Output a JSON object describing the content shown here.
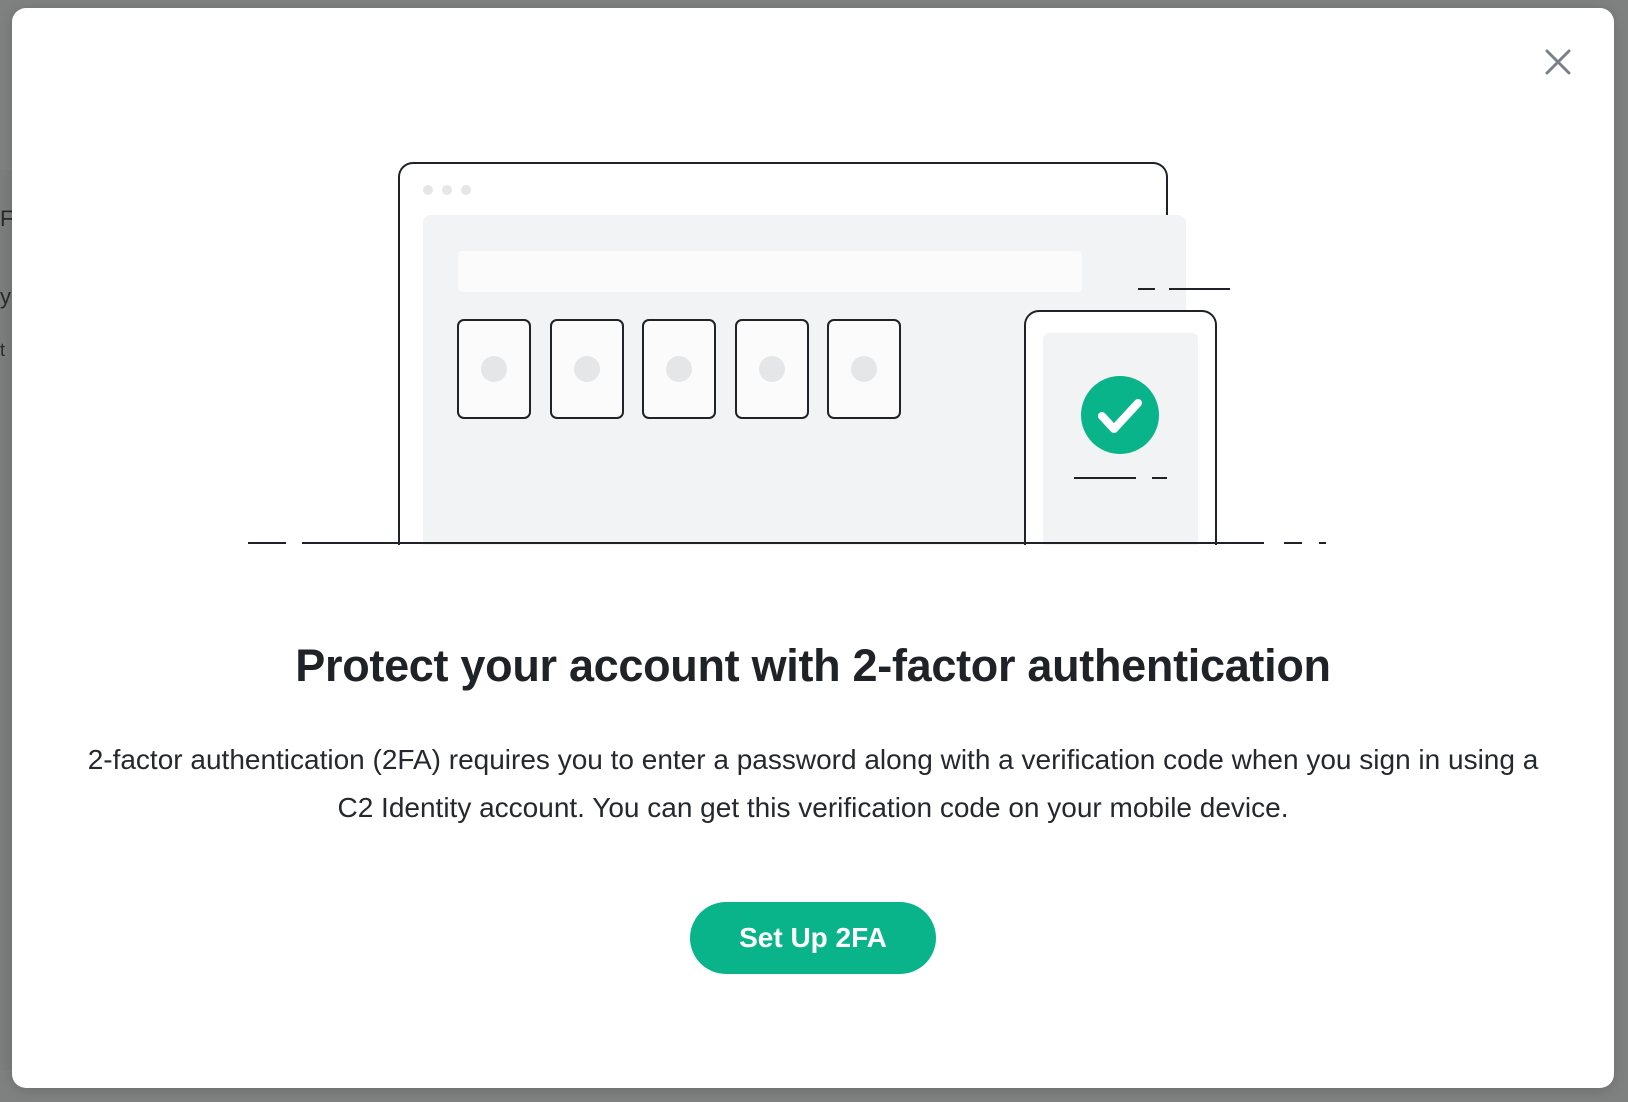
{
  "dialog": {
    "title": "Protect your account with 2-factor authentication",
    "description": "2-factor authentication (2FA) requires you to enter a password along with a verification code when you sign in using a C2 Identity account. You can get this verification code on your mobile device.",
    "primary_button": "Set Up 2FA",
    "close_icon": "close-icon"
  },
  "background_fragments": [
    "FA",
    "yo",
    "t"
  ],
  "illustration": {
    "code_boxes": 5,
    "check_icon": "check-circle-icon"
  },
  "colors": {
    "accent": "#0ab48a",
    "title": "#1f2226",
    "overlay": "#7f8080"
  }
}
